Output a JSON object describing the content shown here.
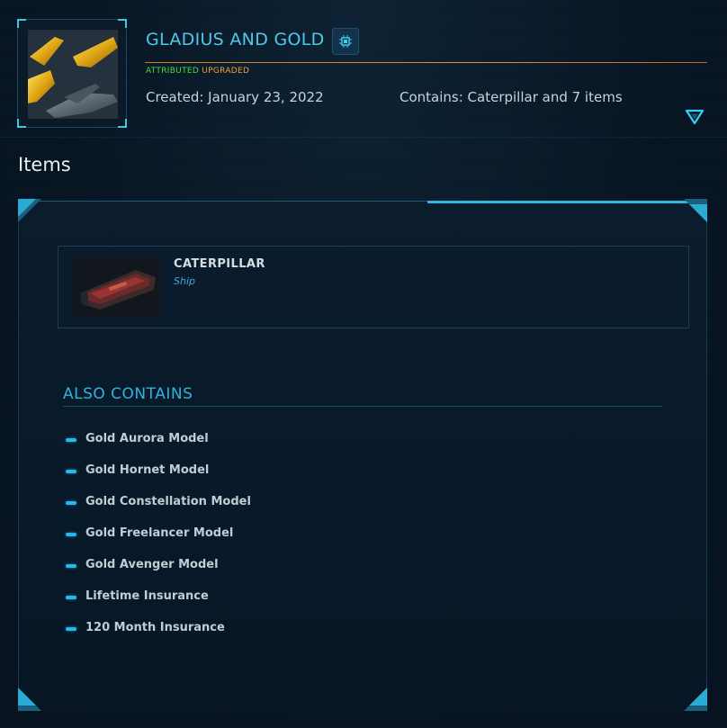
{
  "pledge": {
    "title": "GLADIUS AND GOLD",
    "tag_attributed": "ATTRIBUTED",
    "tag_upgraded": "UPGRADED",
    "created": "Created: January 23, 2022",
    "contains": "Contains: Caterpillar and 7 items",
    "thumbnail_icon": "ship-thumbnail",
    "chip_icon": "chip-icon",
    "expand_icon": "triangle-down-icon"
  },
  "items_section": {
    "heading": "Items",
    "card": {
      "name": "CATERPILLAR",
      "type": "Ship",
      "image_icon": "ship-image"
    }
  },
  "also_contains": {
    "title": "ALSO CONTAINS",
    "items": [
      {
        "label": "Gold Aurora Model"
      },
      {
        "label": "Gold Hornet Model"
      },
      {
        "label": "Gold Constellation Model"
      },
      {
        "label": "Gold Freelancer Model"
      },
      {
        "label": "Gold Avenger Model"
      },
      {
        "label": "Lifetime Insurance"
      },
      {
        "label": "120 Month Insurance"
      }
    ]
  },
  "colors": {
    "background": "#071422",
    "accent": "#2fb8df",
    "title": "#4fc8ec",
    "attributed": "#46e03a",
    "upgraded": "#f4a13a",
    "divider_orange": "#e08c3c"
  }
}
